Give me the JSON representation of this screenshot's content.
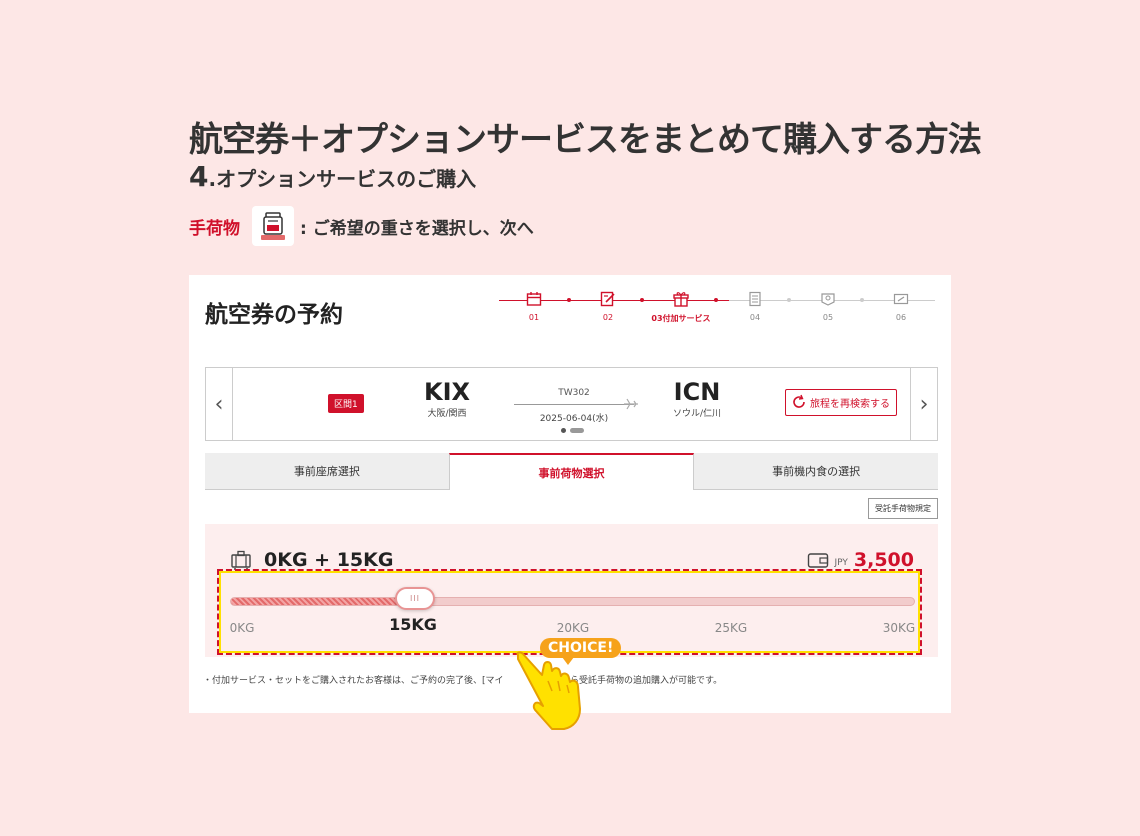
{
  "heading": "航空券＋オプションサービスをまとめて購入する方法",
  "subheading": {
    "number": "4",
    "text": ".オプションサービスのご購入"
  },
  "step": {
    "label": "手荷物",
    "icon": "baggage-scale-icon",
    "instruction": ": ご希望の重さを選択し、次へ"
  },
  "screen": {
    "title": "航空券の予約",
    "progress": {
      "steps": [
        {
          "label": "01",
          "icon": "calendar-icon",
          "done": true
        },
        {
          "label": "02",
          "icon": "edit-doc-icon",
          "done": true
        },
        {
          "label": "03付加サービス",
          "icon": "gift-icon",
          "done": true
        },
        {
          "label": "04",
          "icon": "document-icon",
          "done": false
        },
        {
          "label": "05",
          "icon": "wallet-icon",
          "done": false
        },
        {
          "label": "06",
          "icon": "ticket-icon",
          "done": false
        }
      ]
    },
    "route": {
      "segment_badge": "区間1",
      "origin": {
        "code": "KIX",
        "city": "大阪/関西"
      },
      "flight_no": "TW302",
      "date": "2025-06-04(水)",
      "destination": {
        "code": "ICN",
        "city": "ソウル/仁川"
      },
      "research_button": "旅程を再検索する"
    },
    "tabs": [
      {
        "label": "事前座席選択",
        "active": false
      },
      {
        "label": "事前荷物選択",
        "active": true
      },
      {
        "label": "事前機内食の選択",
        "active": false
      }
    ],
    "rule_button": "受託手荷物規定",
    "baggage": {
      "weight_text": "0KG + 15KG",
      "currency": "JPY",
      "price": "3,500",
      "slider_value_kg": 15,
      "slider_min_kg": 0,
      "slider_max_kg": 30,
      "ticks": [
        "0KG",
        "15KG",
        "20KG",
        "25KG",
        "30KG"
      ],
      "selected_tick": "15KG"
    },
    "footnote": "・付加サービス・セットをご購入されたお客様は、ご予約の完了後、[マイ　　　　予約]から受託手荷物の追加購入が可能です。"
  },
  "callout": {
    "text": "CHOICE!",
    "icon": "pointing-hand-icon"
  },
  "colors": {
    "accent": "#d0112b",
    "background": "#fde7e6",
    "highlight": "#ffe100",
    "callout": "#f6a21a"
  }
}
